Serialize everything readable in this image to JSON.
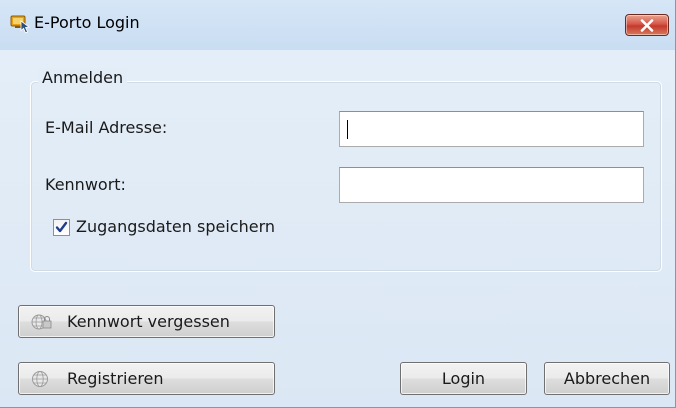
{
  "window": {
    "title": "E-Porto Login",
    "icons": {
      "app": "eporto-app-icon",
      "close": "close-icon"
    }
  },
  "login_group": {
    "legend": "Anmelden",
    "email": {
      "label": "E-Mail Adresse:",
      "value": ""
    },
    "password": {
      "label": "Kennwort:",
      "value": ""
    },
    "remember": {
      "label": "Zugangsdaten speichern",
      "checked": true
    }
  },
  "buttons": {
    "forgot_password": {
      "label": "Kennwort vergessen",
      "icon": "globe-lock-icon"
    },
    "register": {
      "label": "Registrieren",
      "icon": "globe-icon"
    },
    "login": {
      "label": "Login"
    },
    "cancel": {
      "label": "Abbrechen"
    }
  }
}
